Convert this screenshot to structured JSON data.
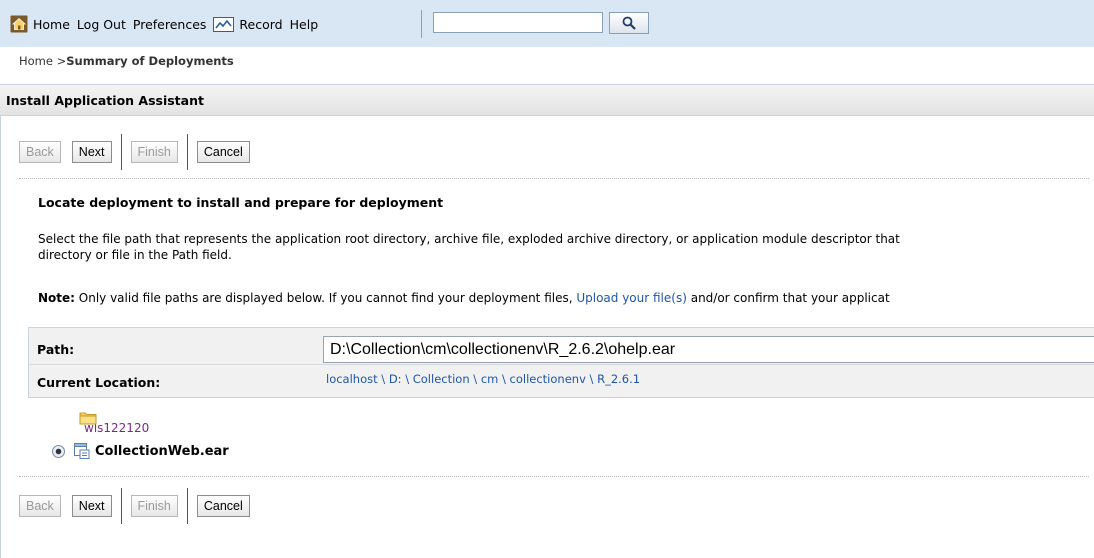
{
  "topnav": {
    "home": "Home",
    "logout": "Log Out",
    "preferences": "Preferences",
    "record": "Record",
    "help": "Help",
    "search_value": ""
  },
  "breadcrumb": {
    "home": "Home >",
    "current": "Summary of Deployments"
  },
  "panel": {
    "title": "Install Application Assistant"
  },
  "buttons": {
    "back": "Back",
    "next": "Next",
    "finish": "Finish",
    "cancel": "Cancel"
  },
  "content": {
    "section_title": "Locate deployment to install and prepare for deployment",
    "desc_line1": "Select the file path that represents the application root directory, archive file, exploded archive directory, or application module descriptor that",
    "desc_line2": "directory or file in the Path field.",
    "note_label": "Note:",
    "note_text1": " Only valid file paths are displayed below. If you cannot find your deployment files, ",
    "note_link": "Upload your file(s)",
    "note_text2": " and/or confirm that your applicat"
  },
  "form": {
    "path_label": "Path:",
    "path_value": "D:\\Collection\\cm\\collectionenv\\R_2.6.2\\ohelp.ear",
    "location_label": "Current Location:",
    "location": [
      "localhost",
      "D:",
      "Collection",
      "cm",
      "collectionenv",
      "R_2.6.1"
    ],
    "location_sep": " \\ "
  },
  "tree": {
    "folder": "wls122120",
    "file": "CollectionWeb.ear"
  },
  "colors": {
    "topbar": "#d9e7f5",
    "link": "#1f56a8",
    "visited": "#7a2a8a"
  }
}
